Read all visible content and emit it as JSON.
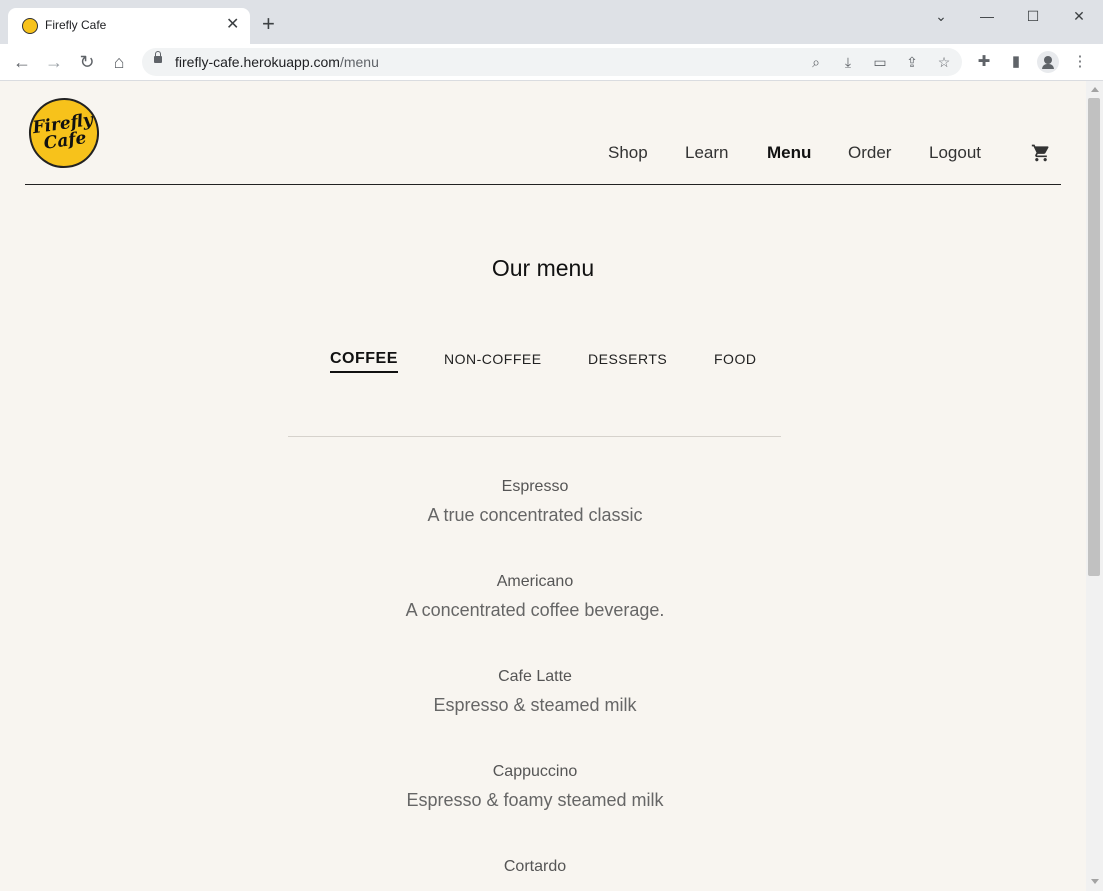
{
  "browser": {
    "tab_title": "Firefly Cafe",
    "url_domain": "firefly-cafe.herokuapp.com",
    "url_path": "/menu"
  },
  "site": {
    "logo_line1": "Firefly",
    "logo_line2": "Cafe",
    "nav": [
      "Shop",
      "Learn",
      "Menu",
      "Order",
      "Logout"
    ],
    "active_nav": "Menu",
    "cart_icon": "shopping-cart-icon"
  },
  "menu_page": {
    "heading": "Our menu",
    "categories": [
      "COFFEE",
      "NON-COFFEE",
      "DESSERTS",
      "FOOD"
    ],
    "active_category": "COFFEE",
    "items": [
      {
        "name": "Espresso",
        "description": "A true concentrated classic"
      },
      {
        "name": "Americano",
        "description": "A concentrated coffee beverage."
      },
      {
        "name": "Cafe Latte",
        "description": "Espresso & steamed milk"
      },
      {
        "name": "Cappuccino",
        "description": "Espresso & foamy steamed milk"
      },
      {
        "name": "Cortardo",
        "description": ""
      }
    ]
  },
  "colors": {
    "page_background": "#f8f5f0",
    "logo_yellow": "#f7c21b",
    "text_dark": "#111111"
  }
}
